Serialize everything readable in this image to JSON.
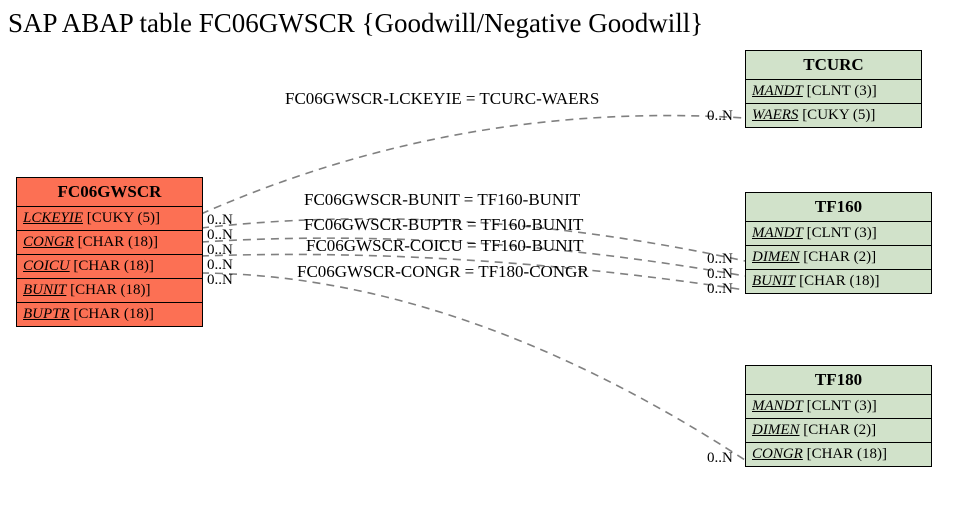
{
  "title": "SAP ABAP table FC06GWSCR {Goodwill/Negative Goodwill}",
  "entities": {
    "main": {
      "name": "FC06GWSCR",
      "fields": [
        {
          "fname": "LCKEYIE",
          "ftype": "[CUKY (5)]"
        },
        {
          "fname": "CONGR",
          "ftype": "[CHAR (18)]"
        },
        {
          "fname": "COICU",
          "ftype": "[CHAR (18)]"
        },
        {
          "fname": "BUNIT",
          "ftype": "[CHAR (18)]"
        },
        {
          "fname": "BUPTR",
          "ftype": "[CHAR (18)]"
        }
      ]
    },
    "tcurc": {
      "name": "TCURC",
      "fields": [
        {
          "fname": "MANDT",
          "ftype": "[CLNT (3)]"
        },
        {
          "fname": "WAERS",
          "ftype": "[CUKY (5)]"
        }
      ]
    },
    "tf160": {
      "name": "TF160",
      "fields": [
        {
          "fname": "MANDT",
          "ftype": "[CLNT (3)]"
        },
        {
          "fname": "DIMEN",
          "ftype": "[CHAR (2)]"
        },
        {
          "fname": "BUNIT",
          "ftype": "[CHAR (18)]"
        }
      ]
    },
    "tf180": {
      "name": "TF180",
      "fields": [
        {
          "fname": "MANDT",
          "ftype": "[CLNT (3)]"
        },
        {
          "fname": "DIMEN",
          "ftype": "[CHAR (2)]"
        },
        {
          "fname": "CONGR",
          "ftype": "[CHAR (18)]"
        }
      ]
    }
  },
  "edges": {
    "e1": {
      "label": "FC06GWSCR-LCKEYIE = TCURC-WAERS",
      "left_card": "",
      "right_card": "0..N"
    },
    "e2": {
      "label": "FC06GWSCR-BUNIT = TF160-BUNIT",
      "left_card": "0..N",
      "right_card": "0..N"
    },
    "e3": {
      "label": "FC06GWSCR-BUPTR = TF160-BUNIT",
      "left_card": "0..N",
      "right_card": "0..N"
    },
    "e4": {
      "label": "FC06GWSCR-COICU = TF160-BUNIT",
      "left_card": "0..N",
      "right_card": "0..N"
    },
    "e5": {
      "label": "FC06GWSCR-CONGR = TF180-CONGR",
      "left_card": "0..N",
      "right_card": "0..N"
    }
  }
}
